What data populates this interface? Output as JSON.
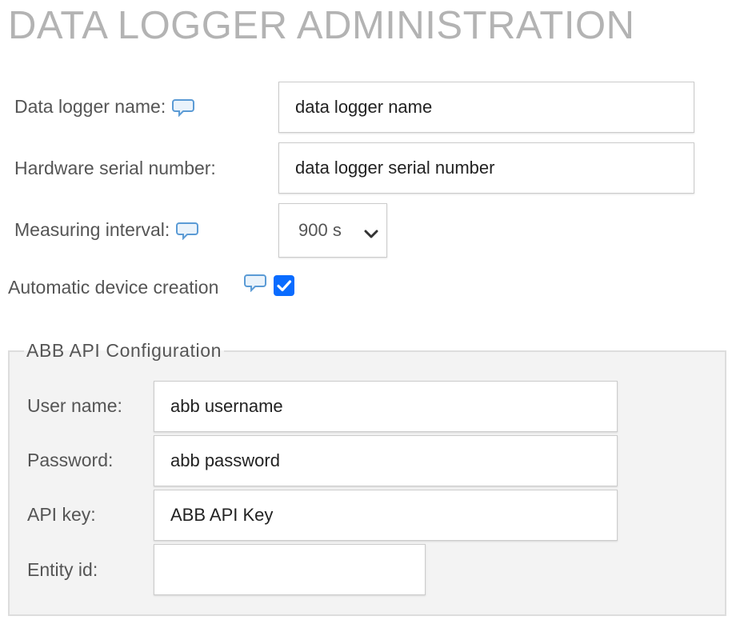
{
  "page": {
    "title": "DATA LOGGER ADMINISTRATION"
  },
  "colors": {
    "accent": "#0a6cff",
    "help_icon": "#5b9bd5",
    "title": "#b3b3b3",
    "fieldset_bg": "#f3f3f3"
  },
  "form": {
    "name": {
      "label": "Data logger name:",
      "value": "data logger name",
      "help_icon": "speech-bubble-icon"
    },
    "serial": {
      "label": "Hardware serial number:",
      "value": "data logger serial number"
    },
    "interval": {
      "label": "Measuring interval:",
      "selected": "900 s",
      "help_icon": "speech-bubble-icon"
    },
    "auto_create": {
      "label": "Automatic device creation",
      "checked": true,
      "help_icon": "speech-bubble-icon"
    }
  },
  "abb": {
    "legend": "ABB API Configuration",
    "username": {
      "label": "User name:",
      "value": "abb username"
    },
    "password": {
      "label": "Password:",
      "value": "abb password"
    },
    "api_key": {
      "label": "API key:",
      "value": "ABB API Key"
    },
    "entity_id": {
      "label": "Entity id:",
      "value": ""
    }
  }
}
